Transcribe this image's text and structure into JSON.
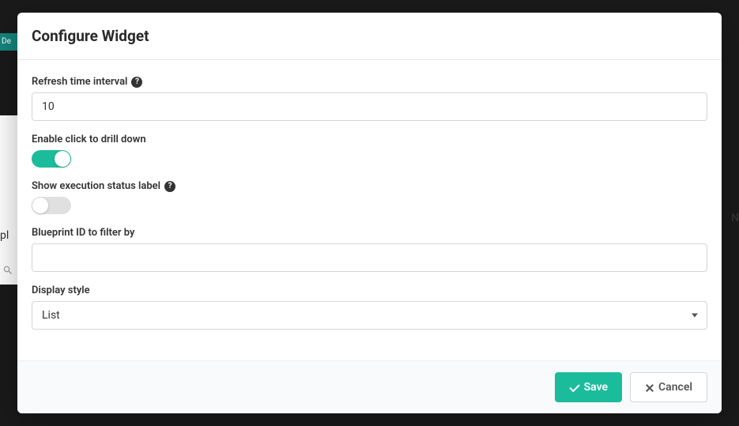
{
  "modal": {
    "title": "Configure Widget",
    "fields": {
      "refresh_interval": {
        "label": "Refresh time interval",
        "value": "10",
        "has_help": true
      },
      "drill_down": {
        "label": "Enable click to drill down",
        "enabled": true
      },
      "status_label": {
        "label": "Show execution status label",
        "enabled": false,
        "has_help": true
      },
      "blueprint_filter": {
        "label": "Blueprint ID to filter by",
        "value": ""
      },
      "display_style": {
        "label": "Display style",
        "selected": "List"
      }
    },
    "buttons": {
      "save": "Save",
      "cancel": "Cancel"
    }
  },
  "background": {
    "teal_fragment": "De",
    "left_fragment": "pl",
    "right_fragment": "N"
  }
}
